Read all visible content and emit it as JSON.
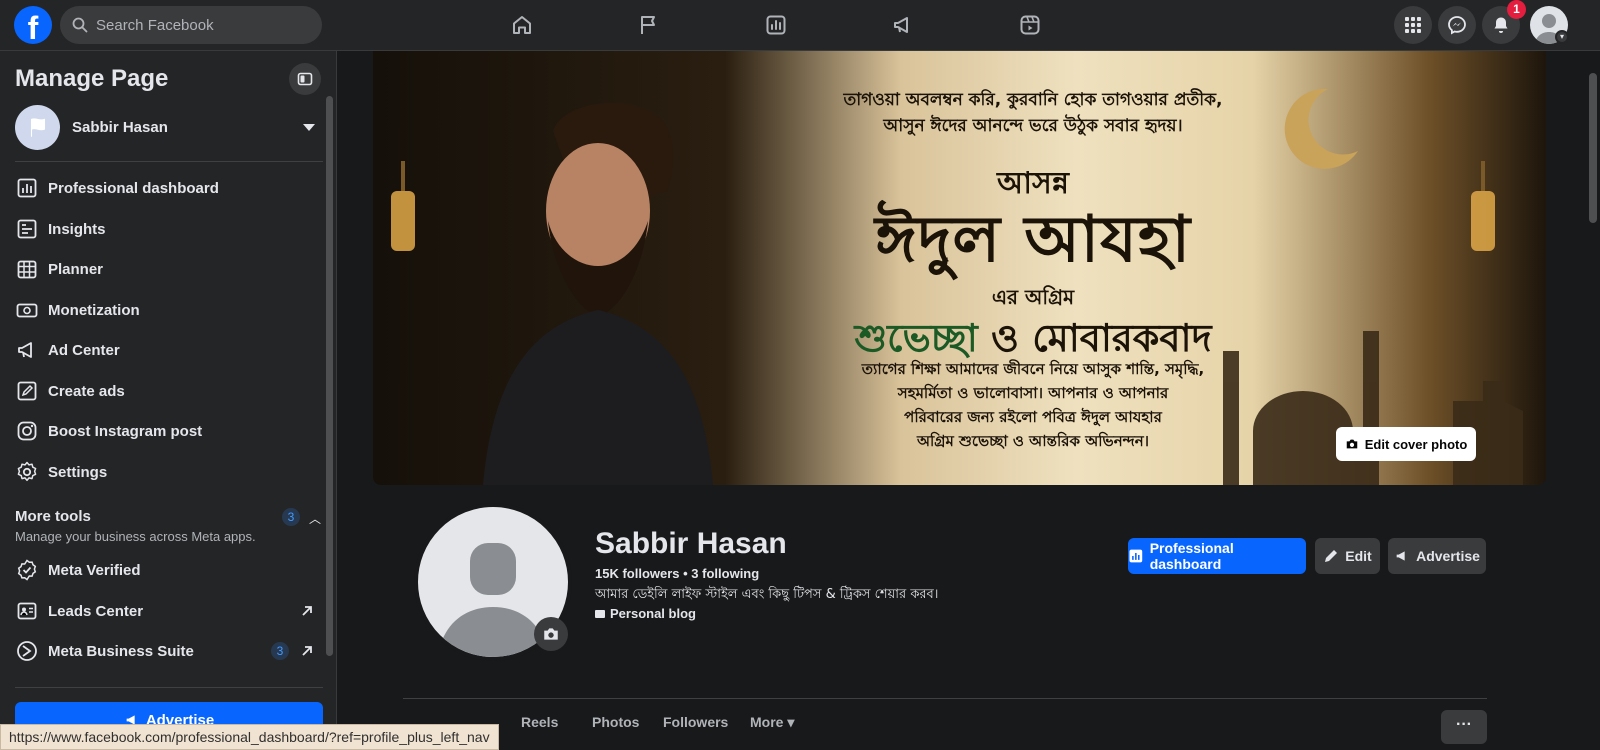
{
  "topbar": {
    "logo": "f",
    "search_placeholder": "Search Facebook",
    "notification_count": "1",
    "icons": [
      "home-icon",
      "flag-icon",
      "insights-icon",
      "megaphone-icon",
      "video-icon",
      "menu-grid-icon",
      "messenger-icon",
      "bell-icon"
    ]
  },
  "sidebar": {
    "title": "Manage Page",
    "profile_name": "Sabbir Hasan",
    "items": [
      {
        "label": "Professional dashboard",
        "icon": "dashboard-icon"
      },
      {
        "label": "Insights",
        "icon": "insights-icon"
      },
      {
        "label": "Planner",
        "icon": "planner-icon"
      },
      {
        "label": "Monetization",
        "icon": "monetization-icon"
      },
      {
        "label": "Ad Center",
        "icon": "megaphone-icon"
      },
      {
        "label": "Create ads",
        "icon": "pencil-icon"
      },
      {
        "label": "Boost Instagram post",
        "icon": "instagram-icon"
      },
      {
        "label": "Settings",
        "icon": "gear-icon"
      }
    ],
    "more_tools": {
      "heading": "More tools",
      "subtitle": "Manage your business across Meta apps.",
      "badge": "3"
    },
    "tools": [
      {
        "label": "Meta Verified",
        "icon": "verified-icon"
      },
      {
        "label": "Leads Center",
        "icon": "leads-icon"
      },
      {
        "label": "Meta Business Suite",
        "icon": "business-suite-icon",
        "badge": "3"
      }
    ],
    "advertise_label": "Advertise"
  },
  "cover": {
    "line1": "তাগওয়া অবলম্বন করি, কুরবানি হোক তাগওয়ার প্রতীক,",
    "line2": "আসুন ঈদের আনন্দে ভরে উঠুক সবার হৃদয়।",
    "subtitle": "আসন্ন",
    "headline": "ঈদুল আযহা",
    "connector": "এর অগ্রিম",
    "greeting_green": "শুভেচ্ছা",
    "greeting_amp": " ও ",
    "greeting_rest": "মোবারকবাদ",
    "body1": "ত্যাগের শিক্ষা আমাদের জীবনে নিয়ে আসুক শান্তি, সমৃদ্ধি,",
    "body2": "সহমর্মিতা ও ভালোবাসা। আপনার ও আপনার",
    "body3": "পরিবারের জন্য রইলো পবিত্র ঈদুল আযহার",
    "body4": "অগ্রিম শুভেচ্ছা ও আন্তরিক অভিনন্দন।",
    "edit_label": "Edit cover photo"
  },
  "profile": {
    "name": "Sabbir Hasan",
    "followers": "15K followers • 3 following",
    "bio": "আমার ডেইলি লাইফ স্টাইল এবং কিছু টিপস & ট্রিকস শেয়ার করব।",
    "category": "Personal blog"
  },
  "actions": {
    "dashboard": "Professional dashboard",
    "edit": "Edit",
    "advertise": "Advertise"
  },
  "tabs": [
    "Reels",
    "Photos",
    "Followers",
    "More ▾"
  ],
  "tabs_more_dots": "···",
  "status_url": "https://www.facebook.com/professional_dashboard/?ref=profile_plus_left_nav",
  "colors": {
    "accent": "#0866ff",
    "background": "#18191a",
    "surface": "#242526",
    "notification": "#e41e3f"
  }
}
